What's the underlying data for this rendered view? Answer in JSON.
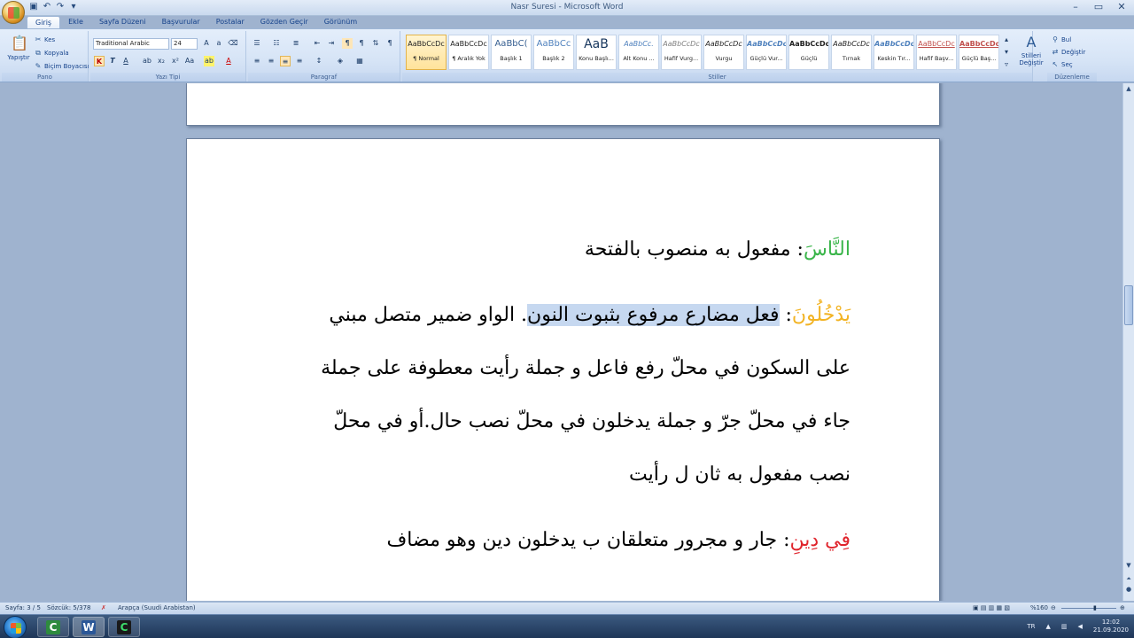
{
  "window": {
    "title": "Nasr Suresi - Microsoft Word",
    "qat": [
      "save-icon",
      "undo-icon",
      "redo-icon",
      "customize-icon"
    ]
  },
  "tabs": [
    "Giriş",
    "Ekle",
    "Sayfa Düzeni",
    "Başvurular",
    "Postalar",
    "Gözden Geçir",
    "Görünüm"
  ],
  "ribbon": {
    "clipboard": {
      "label": "Pano",
      "paste": "Yapıştır",
      "cut": "Kes",
      "copy": "Kopyala",
      "format_painter": "Biçim Boyacısı"
    },
    "font": {
      "label": "Yazı Tipi",
      "name": "Traditional Arabic",
      "size": "24",
      "bold": "K",
      "italic": "T",
      "underline": "A"
    },
    "paragraph": {
      "label": "Paragraf"
    },
    "styles": {
      "label": "Stiller",
      "items": [
        {
          "sample": "AaBbCcDc",
          "name": "¶ Normal"
        },
        {
          "sample": "AaBbCcDc",
          "name": "¶ Aralık Yok"
        },
        {
          "sample": "AaBbC(",
          "name": "Başlık 1"
        },
        {
          "sample": "AaBbCc",
          "name": "Başlık 2"
        },
        {
          "sample": "AaB",
          "name": "Konu Başlı..."
        },
        {
          "sample": "AaBbCc.",
          "name": "Alt Konu ..."
        },
        {
          "sample": "AaBbCcDc",
          "name": "Hafif Vurg..."
        },
        {
          "sample": "AaBbCcDc",
          "name": "Vurgu"
        },
        {
          "sample": "AaBbCcDc",
          "name": "Güçlü Vur..."
        },
        {
          "sample": "AaBbCcDc",
          "name": "Güçlü"
        },
        {
          "sample": "AaBbCcDc",
          "name": "Tırnak"
        },
        {
          "sample": "AaBbCcDc",
          "name": "Keskin Tır..."
        },
        {
          "sample": "AaBbCcDc",
          "name": "Hafif Başv..."
        },
        {
          "sample": "AaBbCcDc",
          "name": "Güçlü Baş..."
        }
      ],
      "change_styles": "Stilleri Değiştir"
    },
    "editing": {
      "label": "Düzenleme",
      "find": "Bul",
      "replace": "Değiştir",
      "select": "Seç"
    }
  },
  "document": {
    "line1": {
      "keyword": "النَّاسَ",
      "text": ": مفعول به منصوب بالفتحة"
    },
    "line2": {
      "keyword": "يَدْخُلُونَ",
      "sep": ": ",
      "highlight": "فعل مضارع مرفوع بثبوت النون",
      "text": ". الواو ضمير متصل مبني"
    },
    "line3": "على السكون في محلّ رفع فاعل و جملة رأيت معطوفة على جملة",
    "line4": "جاء في محلّ جرّ و جملة يدخلون في محلّ نصب حال.أو في محلّ",
    "line5": "نصب مفعول به ثان ل رأيت",
    "line6": {
      "keyword": "فِي دِينِ",
      "text": ": جار و مجرور متعلقان ب يدخلون دين وهو مضاف"
    }
  },
  "status": {
    "page": "Sayfa: 3 / 5",
    "words": "Sözcük: 5/378",
    "language": "Arapça (Suudi Arabistan)",
    "zoom": "%160"
  },
  "taskbar": {
    "lang": "TR",
    "time": "12:02",
    "date": "21.09.2020"
  },
  "colors": {
    "green_keyword": "#3ab54a",
    "orange_keyword": "#f2b323",
    "red_keyword": "#e0242c",
    "selection": "#c6d8f0"
  }
}
